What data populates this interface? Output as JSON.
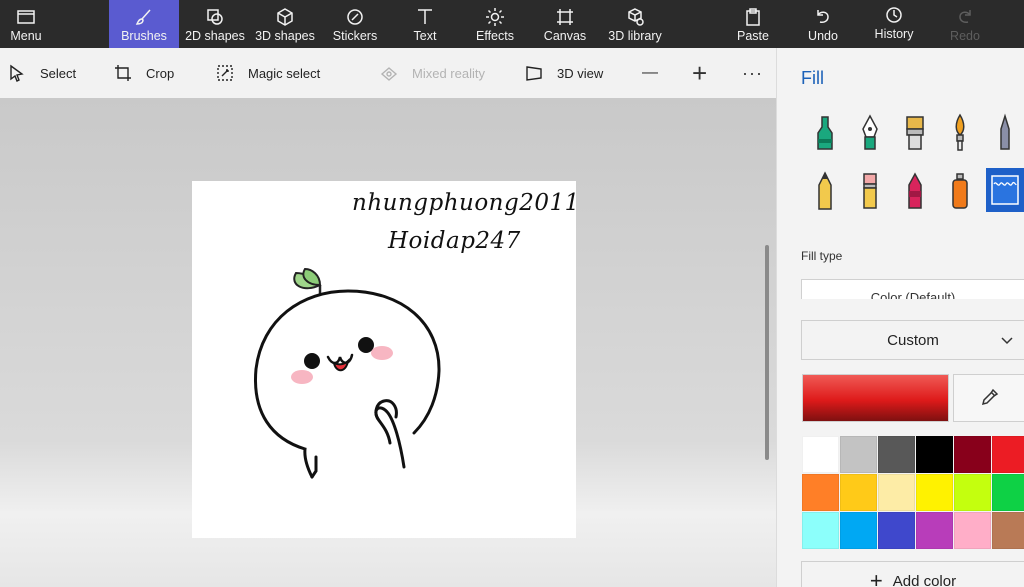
{
  "toolbar": {
    "menu": "Menu",
    "brushes": "Brushes",
    "shapes2d": "2D shapes",
    "shapes3d": "3D shapes",
    "stickers": "Stickers",
    "text": "Text",
    "effects": "Effects",
    "canvas": "Canvas",
    "library3d": "3D library",
    "paste": "Paste",
    "undo": "Undo",
    "history": "History",
    "redo": "Redo"
  },
  "subtoolbar": {
    "select": "Select",
    "crop": "Crop",
    "magic_select": "Magic select",
    "mixed_reality": "Mixed reality",
    "view3d": "3D view",
    "zoom_out": "—",
    "zoom_in": "+",
    "more": "···"
  },
  "canvas": {
    "text_line1": "nhungphuong2011",
    "text_line2": "Hoidap247"
  },
  "panel": {
    "title": "Fill",
    "brushes": [
      "marker",
      "calligraphy-pen",
      "oil-brush",
      "watercolor",
      "pixel-pen",
      "pencil",
      "eraser",
      "crayon",
      "spray-can",
      "fill"
    ],
    "fill_type_label": "Fill type",
    "fill_type_value": "Color (Default)",
    "dropdown_value": "Custom",
    "current_color": "#e02020",
    "palette": [
      "#ffffff",
      "#c3c3c3",
      "#585858",
      "#000000",
      "#88001b",
      "#ec1c24",
      "#ff7f27",
      "#ffca18",
      "#fdeca6",
      "#fff200",
      "#c4ff0e",
      "#0ed145",
      "#8cfffb",
      "#00a8f3",
      "#3f48cc",
      "#b83dba",
      "#ffaec8",
      "#b97a56"
    ],
    "add_color": "Add color"
  },
  "colors": {
    "accent": "#5a5bd0",
    "title_blue": "#1d62b8",
    "selected_brush": "#1e60c8"
  }
}
